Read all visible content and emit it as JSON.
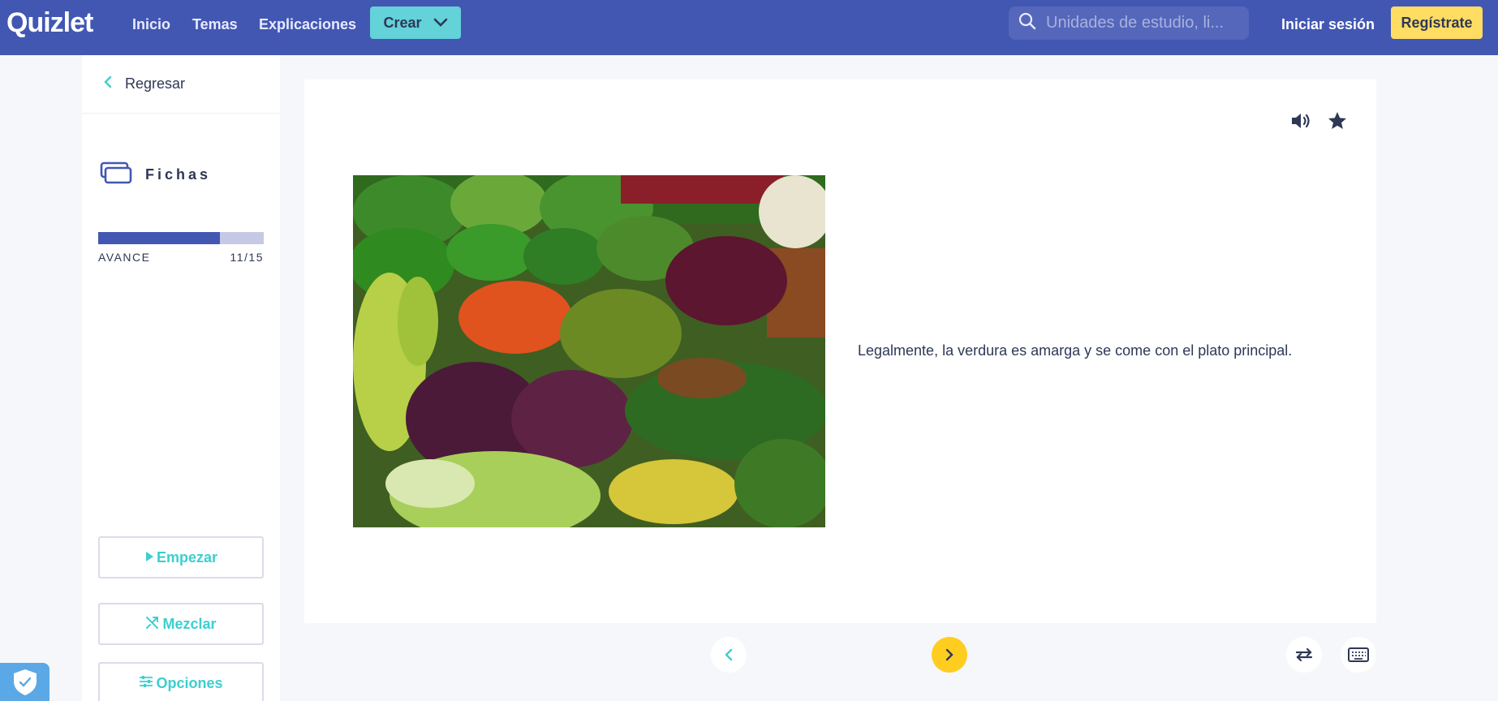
{
  "header": {
    "logo": "Quizlet",
    "nav": [
      "Inicio",
      "Temas",
      "Explicaciones"
    ],
    "create_label": "Crear",
    "search_placeholder": "Unidades de estudio, li...",
    "login_label": "Iniciar sesión",
    "signup_label": "Regístrate"
  },
  "sidebar": {
    "back_label": "Regresar",
    "mode_label": "Fichas",
    "progress_label": "AVANCE",
    "progress_count": "11/15",
    "progress_fraction": 0.7333,
    "buttons": {
      "start": "Empezar",
      "shuffle": "Mezclar",
      "options": "Opciones"
    }
  },
  "card": {
    "definition": "Legalmente, la verdura es amarga y se come con el plato principal."
  },
  "colors": {
    "brand": "#4257b2",
    "accent_teal": "#3ccfcf",
    "signup_yellow": "#ffdc62",
    "next_yellow": "#ffcd1f"
  }
}
